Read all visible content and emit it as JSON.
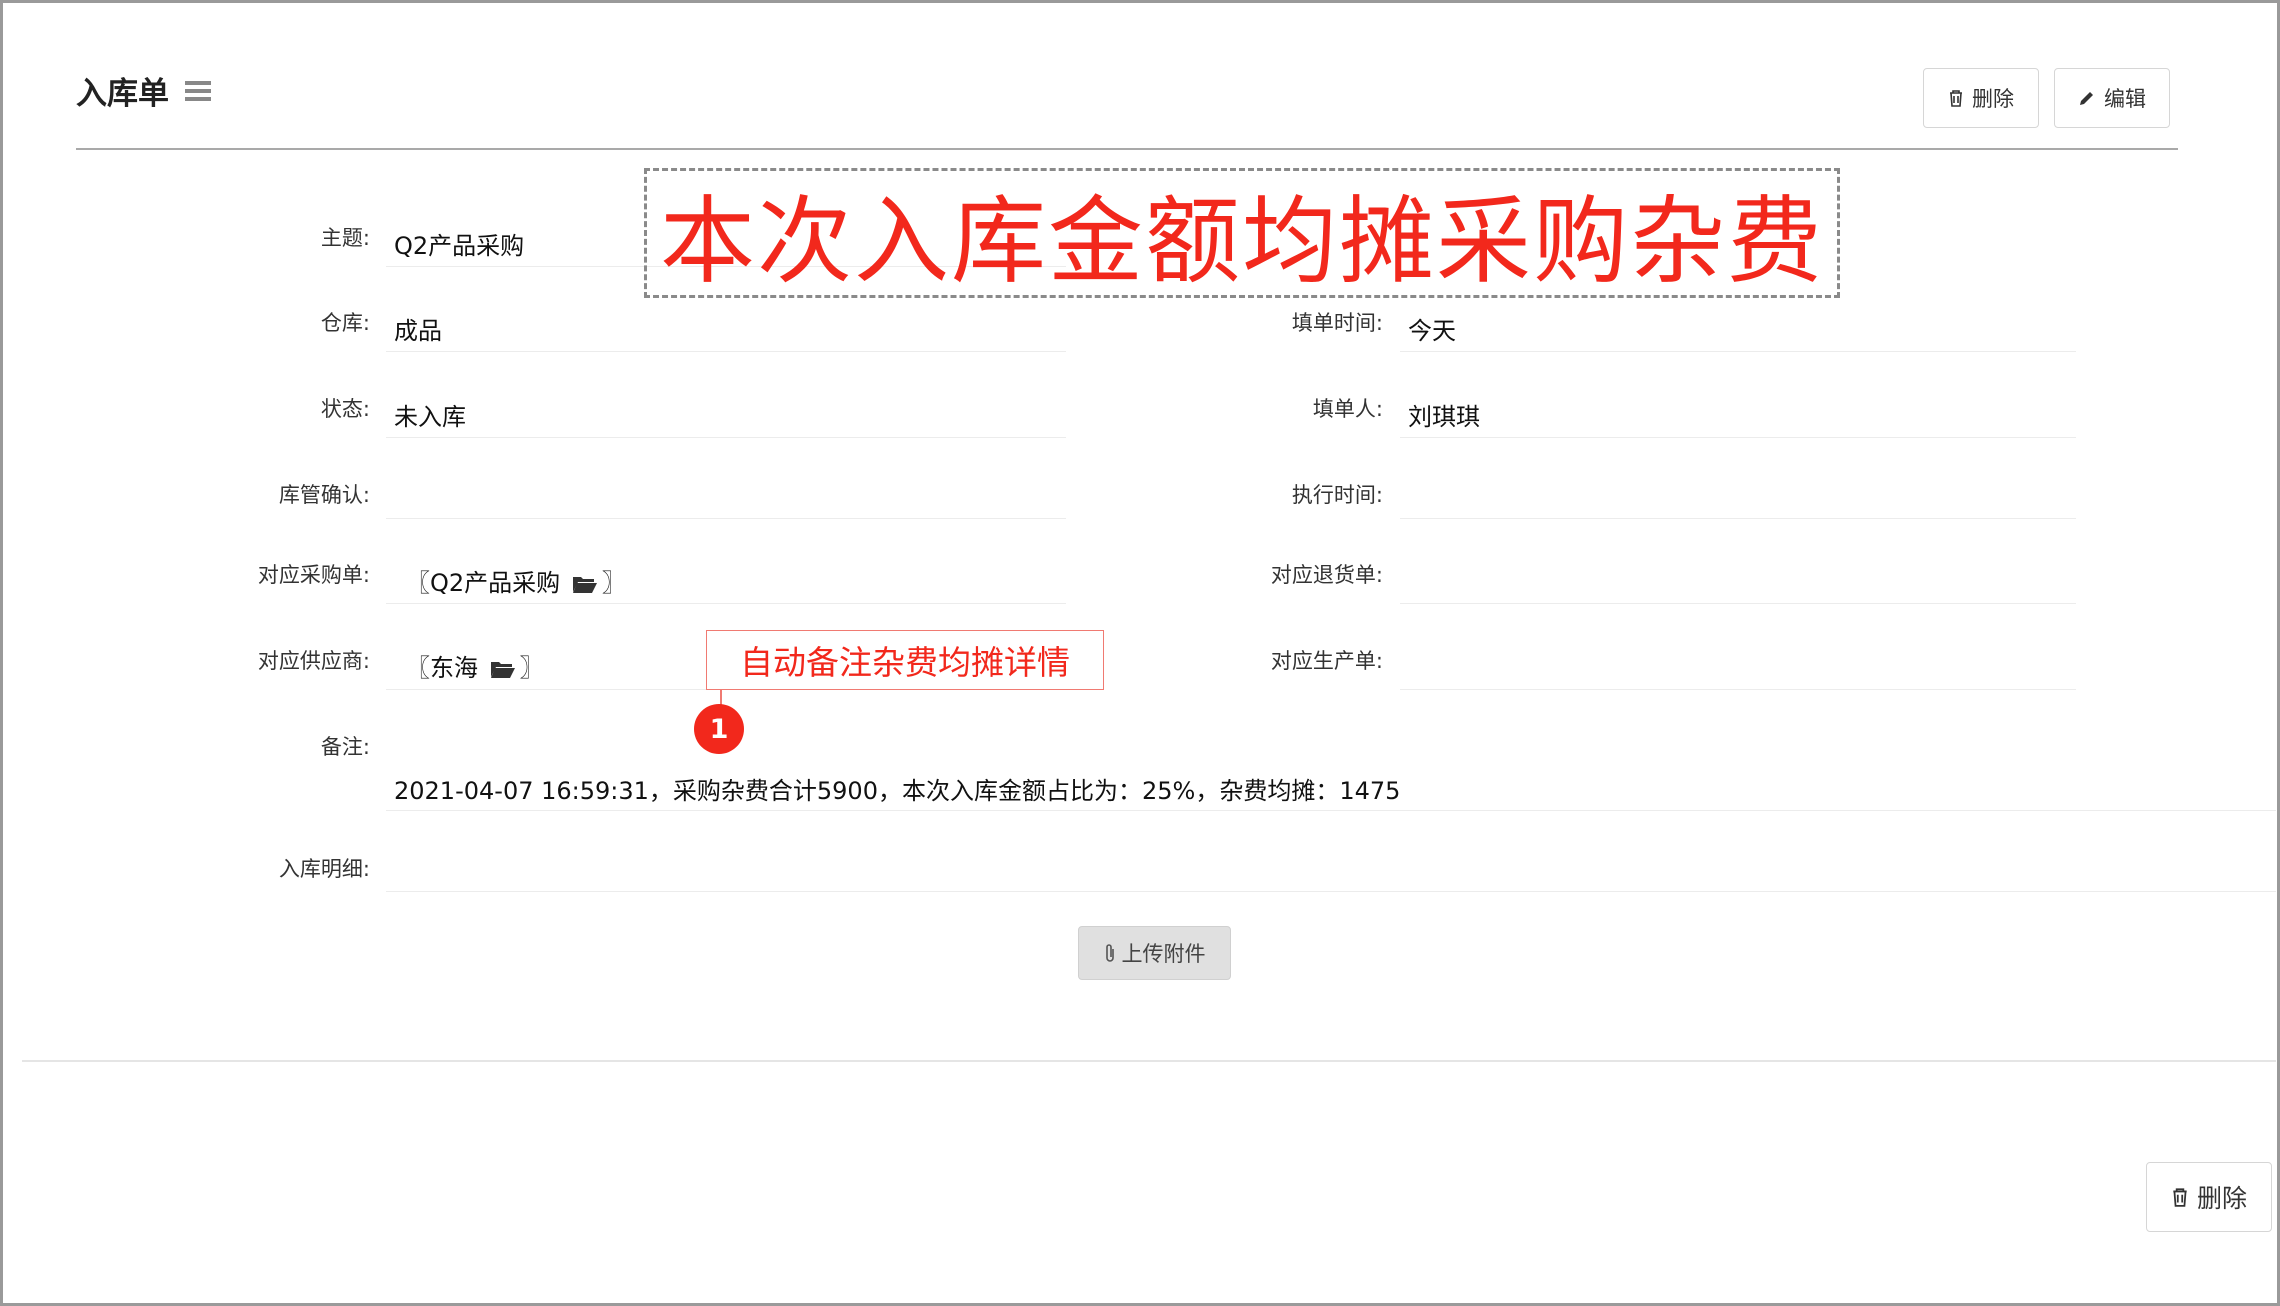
{
  "header": {
    "title": "入库单",
    "delete_label": "删除",
    "edit_label": "编辑"
  },
  "annotations": {
    "banner": "本次入库金额均摊采购杂费",
    "callout": "自动备注杂费均摊详情",
    "marker": "1"
  },
  "form": {
    "subject": {
      "label": "主题:",
      "value": "Q2产品采购"
    },
    "warehouse": {
      "label": "仓库:",
      "value": "成品"
    },
    "fill_time": {
      "label": "填单时间:",
      "value": "今天"
    },
    "status": {
      "label": "状态:",
      "value": "未入库"
    },
    "filler": {
      "label": "填单人:",
      "value": "刘琪琪"
    },
    "keeper_confirm": {
      "label": "库管确认:",
      "value": ""
    },
    "exec_time": {
      "label": "执行时间:",
      "value": ""
    },
    "purchase_order": {
      "label": "对应采购单:",
      "open": "〖",
      "value": "Q2产品采购",
      "close": "〗"
    },
    "return_order": {
      "label": "对应退货单:",
      "value": ""
    },
    "supplier": {
      "label": "对应供应商:",
      "open": "〖",
      "value": "东海",
      "close": "〗"
    },
    "production_order": {
      "label": "对应生产单:",
      "value": ""
    },
    "remark": {
      "label": "备注:",
      "value": "2021-04-07 16:59:31，采购杂费合计5900，本次入库金额占比为：25%，杂费均摊：1475"
    },
    "detail": {
      "label": "入库明细:",
      "value": ""
    }
  },
  "upload_label": "上传附件",
  "footer": {
    "delete_label": "删除"
  }
}
